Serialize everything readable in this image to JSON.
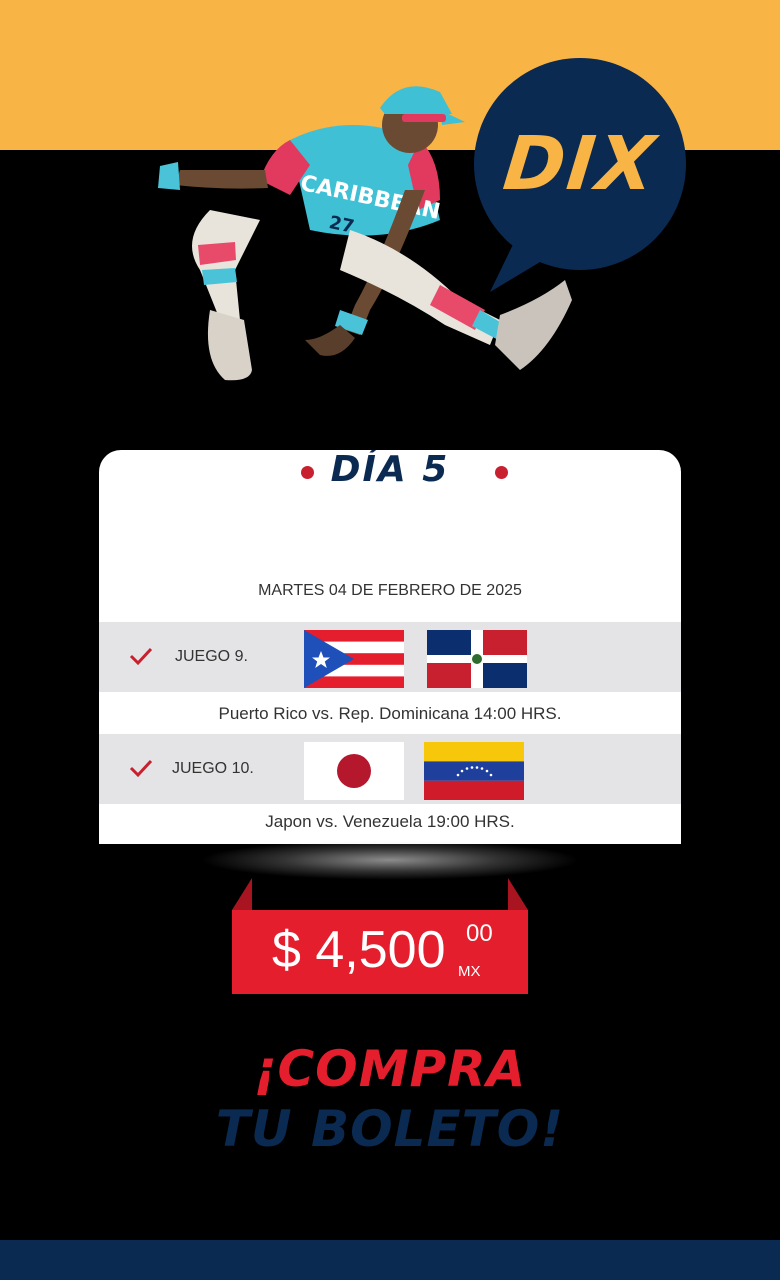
{
  "brand": {
    "logo_text": "DIX",
    "jersey_text": "CARIBBEAN",
    "jersey_number": "27"
  },
  "event": {
    "day_title": "DÍA 5",
    "date": "MARTES 04 DE FEBRERO DE 2025",
    "games": [
      {
        "label": "JUEGO 9.",
        "team_a": "Puerto Rico",
        "team_b": "Rep. Dominicana",
        "flag_a": "puerto-rico-flag",
        "flag_b": "dominican-republic-flag",
        "match_text": "Puerto Rico vs. Rep. Dominicana 14:00 HRS."
      },
      {
        "label": "JUEGO 10.",
        "team_a": "Japon",
        "team_b": "Venezuela",
        "flag_a": "japan-flag",
        "flag_b": "venezuela-flag",
        "match_text": "Japon vs. Venezuela  19:00 HRS."
      }
    ]
  },
  "price": {
    "amount": "$ 4,500",
    "cents": "00",
    "currency": "MX"
  },
  "cta": {
    "line1": "¡COMPRA",
    "line2": "TU BOLETO!"
  },
  "colors": {
    "yellow": "#f8b445",
    "navy": "#0a2a52",
    "red": "#e41e2d",
    "background": "#000000"
  }
}
